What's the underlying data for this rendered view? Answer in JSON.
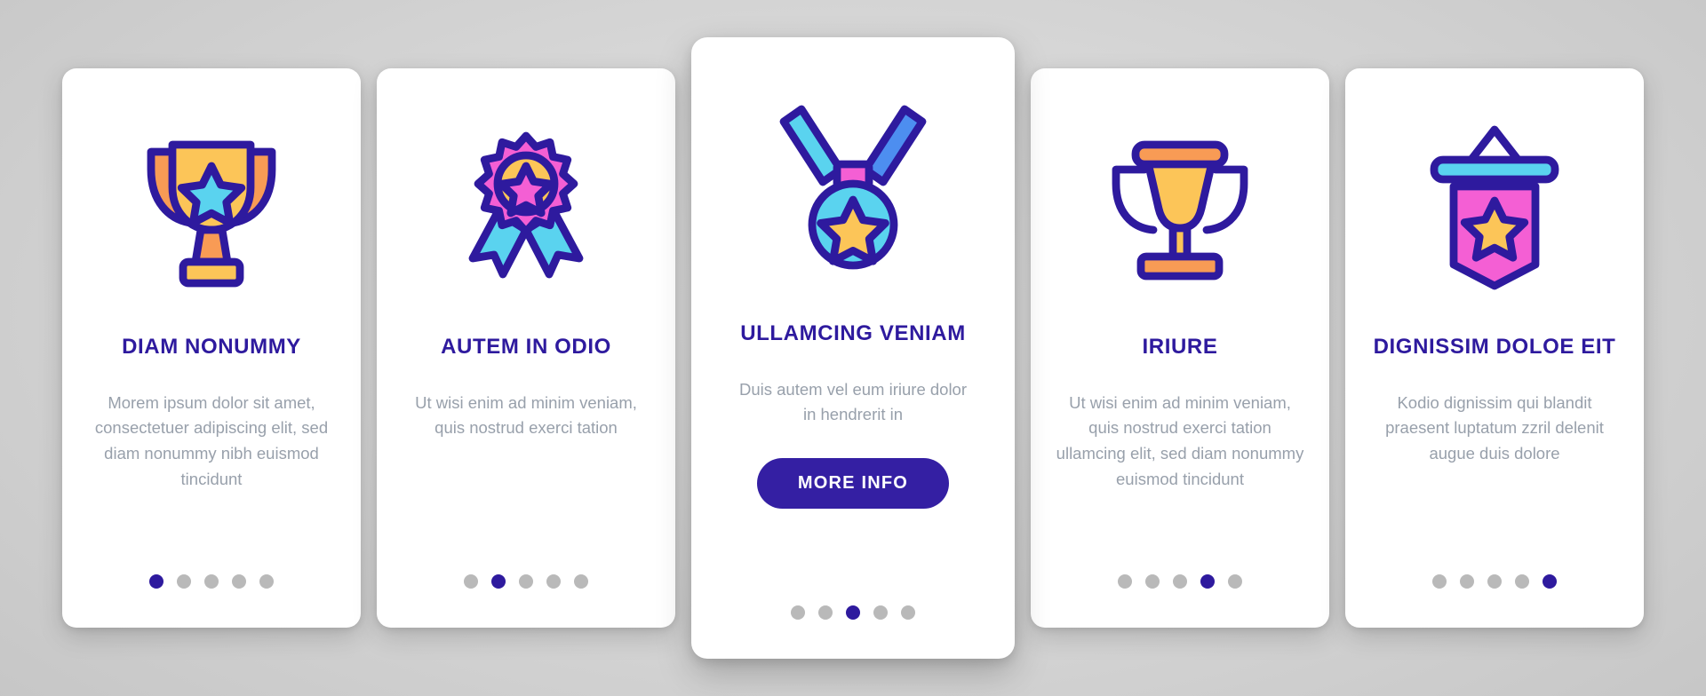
{
  "theme": {
    "background": "#d6d6d6",
    "card_background": "#ffffff",
    "title_color": "#2e1a9e",
    "body_color": "#98a0ab",
    "accent_color": "#341fa3",
    "dot_inactive": "#b9b9b9",
    "outline": "#2e1a9e",
    "yellow": "#fcc558",
    "orange": "#f89b55",
    "cyan": "#5ad3ef",
    "blue": "#4d8ef0",
    "pink": "#f45fd4"
  },
  "cards": [
    {
      "icon": "trophy-star-icon",
      "title": "DIAM NONUMMY",
      "body": "Morem ipsum dolor sit amet, consectetuer adipiscing elit, sed diam nonummy nibh euismod tincidunt",
      "dots": {
        "count": 5,
        "active_index": 0
      },
      "featured": false,
      "button_label": null
    },
    {
      "icon": "award-rosette-ribbon-icon",
      "title": "AUTEM IN ODIO",
      "body": "Ut wisi enim ad minim veniam, quis nostrud exerci tation",
      "dots": {
        "count": 5,
        "active_index": 1
      },
      "featured": false,
      "button_label": null
    },
    {
      "icon": "medal-star-icon",
      "title": "ULLAMCING VENIAM",
      "body": "Duis autem vel eum iriure dolor in hendrerit in",
      "dots": {
        "count": 5,
        "active_index": 2
      },
      "featured": true,
      "button_label": "MORE INFO"
    },
    {
      "icon": "trophy-cup-icon",
      "title": "IRIURE",
      "body": "Ut wisi enim ad minim veniam, quis nostrud exerci tation ullamcing elit, sed diam nonummy euismod tincidunt",
      "dots": {
        "count": 5,
        "active_index": 3
      },
      "featured": false,
      "button_label": null
    },
    {
      "icon": "pennant-star-icon",
      "title": "DIGNISSIM DOLOE EIT",
      "body": "Kodio dignissim qui blandit praesent luptatum zzril delenit augue duis dolore",
      "dots": {
        "count": 5,
        "active_index": 4
      },
      "featured": false,
      "button_label": null
    }
  ]
}
